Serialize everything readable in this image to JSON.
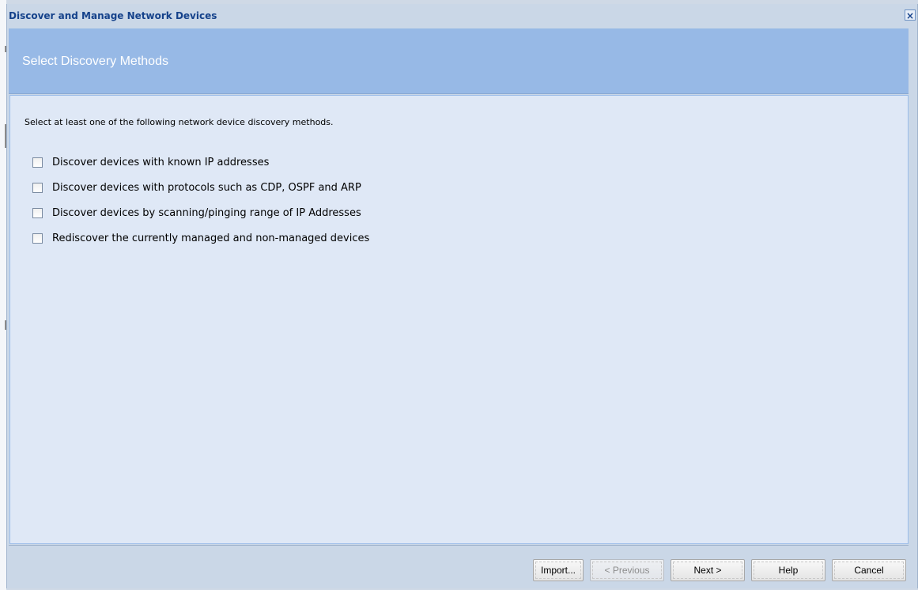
{
  "window": {
    "title": "Discover and Manage Network Devices",
    "close_icon": "close-icon",
    "close_glyph": "×"
  },
  "header": {
    "title": "Select Discovery Methods"
  },
  "content": {
    "instruction": "Select at least one of the following network device discovery methods.",
    "options": [
      {
        "label": "Discover devices with known IP addresses",
        "checked": false
      },
      {
        "label": "Discover devices with protocols such as CDP, OSPF and ARP",
        "checked": false
      },
      {
        "label": "Discover devices by scanning/pinging range of IP Addresses",
        "checked": false
      },
      {
        "label": "Rediscover the currently managed and non-managed devices",
        "checked": false
      }
    ]
  },
  "footer": {
    "import_label": "Import...",
    "previous_label": "< Previous",
    "previous_enabled": false,
    "next_label": "Next >",
    "help_label": "Help",
    "cancel_label": "Cancel"
  },
  "colors": {
    "title_text": "#15428b",
    "header_band": "#97b9e6",
    "content_bg": "#dfe8f6",
    "frame_bg": "#cad7e7"
  }
}
